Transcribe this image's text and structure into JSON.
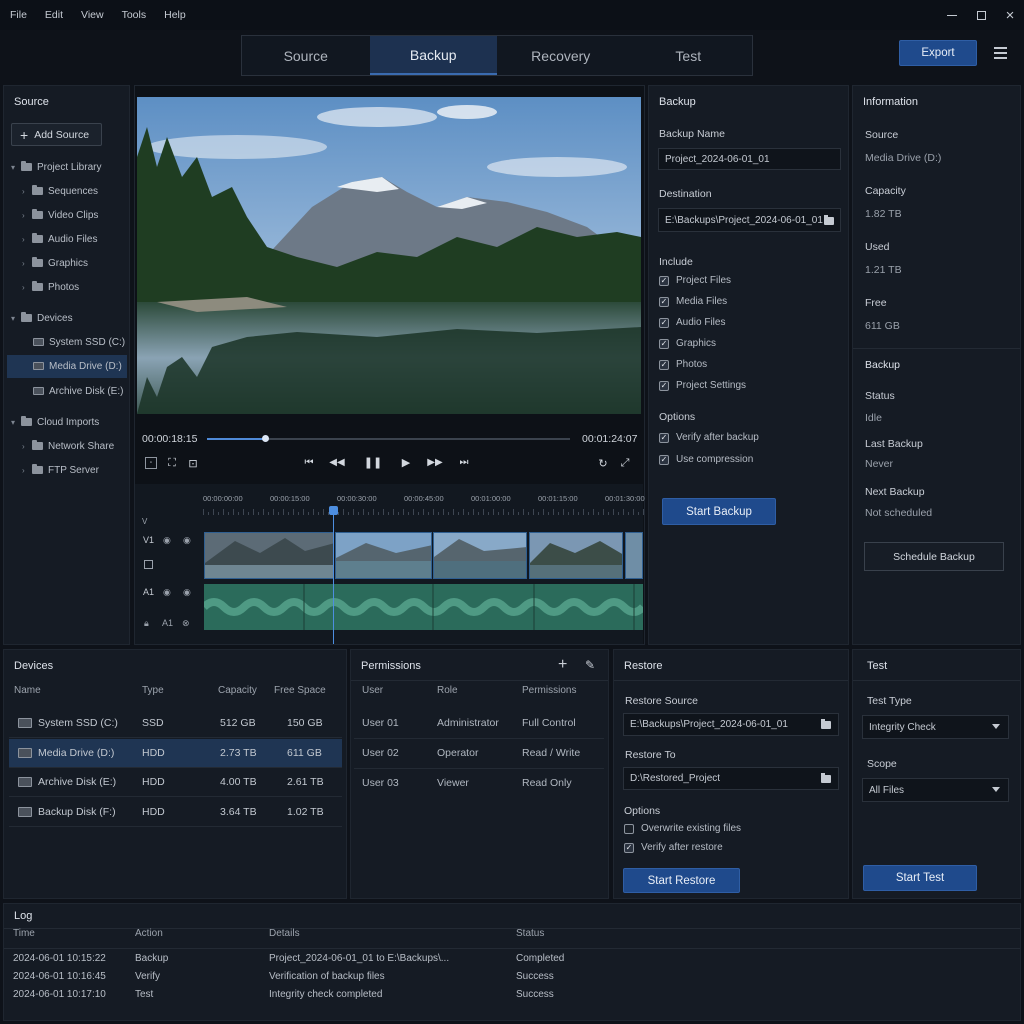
{
  "menu": [
    "File",
    "Edit",
    "View",
    "Tools",
    "Help"
  ],
  "window_icons": [
    "minimize-icon",
    "maximize-icon",
    "close-icon"
  ],
  "tabs": [
    {
      "label": "Source"
    },
    {
      "label": "Backup",
      "active": true
    },
    {
      "label": "Recovery"
    },
    {
      "label": "Test"
    }
  ],
  "export_label": "Export",
  "source_panel": {
    "title": "Source",
    "add_label": "Add Source",
    "library": "Project Library",
    "library_items": [
      "Sequences",
      "Video Clips",
      "Audio Files",
      "Graphics",
      "Photos"
    ],
    "devices": "Devices",
    "device_items": [
      "System SSD (C:)",
      "Media Drive (D:)",
      "Archive Disk (E:)"
    ],
    "selected_device": "Media Drive (D:)",
    "cloud": "Cloud Imports",
    "cloud_items": [
      "Network Share",
      "FTP Server"
    ]
  },
  "player": {
    "current_time": "00:00:18:15",
    "total_time": "00:01:24:07",
    "progress": 0.16
  },
  "timeline": {
    "ruler": [
      "00:00:00:00",
      "00:00:15:00",
      "00:00:30:00",
      "00:00:45:00",
      "00:01:00:00",
      "00:01:15:00",
      "00:01:30:00"
    ],
    "video_track": "V1",
    "audio_track": "A1",
    "audio_track_2": "A1",
    "v_label": "V"
  },
  "backup": {
    "title": "Backup",
    "name_label": "Backup Name",
    "name_value": "Project_2024-06-01_01",
    "dest_label": "Destination",
    "dest_value": "E:\\Backups\\Project_2024-06-01_01",
    "include_label": "Include",
    "include": [
      {
        "label": "Project Files",
        "checked": true
      },
      {
        "label": "Media Files",
        "checked": true
      },
      {
        "label": "Audio Files",
        "checked": true
      },
      {
        "label": "Graphics",
        "checked": true
      },
      {
        "label": "Photos",
        "checked": true
      },
      {
        "label": "Project Settings",
        "checked": true
      }
    ],
    "options_label": "Options",
    "options": [
      {
        "label": "Verify after backup",
        "checked": true
      },
      {
        "label": "Use compression",
        "checked": true
      }
    ],
    "start_label": "Start Backup"
  },
  "info": {
    "title": "Information",
    "source_label": "Source",
    "source_value": "Media Drive (D:)",
    "capacity_label": "Capacity",
    "capacity_value": "1.82 TB",
    "used_label": "Used",
    "used_value": "1.21 TB",
    "free_label": "Free",
    "free_value": "611 GB",
    "backup_heading": "Backup",
    "status_label": "Status",
    "status_value": "Idle",
    "last_label": "Last Backup",
    "last_value": "Never",
    "next_label": "Next Backup",
    "next_value": "Not scheduled",
    "schedule_label": "Schedule Backup"
  },
  "devices_table": {
    "title": "Devices",
    "headers": [
      "Name",
      "Type",
      "Capacity",
      "Free Space"
    ],
    "rows": [
      [
        "System SSD (C:)",
        "SSD",
        "512 GB",
        "150 GB"
      ],
      [
        "Media Drive (D:)",
        "HDD",
        "2.73 TB",
        "611 GB"
      ],
      [
        "Archive Disk (E:)",
        "HDD",
        "4.00 TB",
        "2.61 TB"
      ],
      [
        "Backup Disk (F:)",
        "HDD",
        "3.64 TB",
        "1.02 TB"
      ]
    ],
    "selected_row": 1
  },
  "permissions": {
    "title": "Permissions",
    "headers": [
      "User",
      "Role",
      "Permissions"
    ],
    "rows": [
      [
        "User 01",
        "Administrator",
        "Full Control"
      ],
      [
        "User 02",
        "Operator",
        "Read / Write"
      ],
      [
        "User 03",
        "Viewer",
        "Read Only"
      ]
    ]
  },
  "restore": {
    "title": "Restore",
    "source_label": "Restore Source",
    "source_value": "E:\\Backups\\Project_2024-06-01_01",
    "to_label": "Restore To",
    "to_value": "D:\\Restored_Project",
    "options_label": "Options",
    "options": [
      {
        "label": "Overwrite existing files",
        "checked": false
      },
      {
        "label": "Verify after restore",
        "checked": true
      }
    ],
    "start_label": "Start Restore"
  },
  "test": {
    "title": "Test",
    "type_label": "Test Type",
    "type_value": "Integrity Check",
    "scope_label": "Scope",
    "scope_value": "All Files",
    "start_label": "Start Test"
  },
  "log": {
    "title": "Log",
    "headers": [
      "Time",
      "Action",
      "Details",
      "Status"
    ],
    "rows": [
      [
        "2024-06-01 10:15:22",
        "Backup",
        "Project_2024-06-01_01 to E:\\Backups\\...",
        "Completed"
      ],
      [
        "2024-06-01 10:16:45",
        "Verify",
        "Verification of backup files",
        "Success"
      ],
      [
        "2024-06-01 10:17:10",
        "Test",
        "Integrity check completed",
        "Success"
      ]
    ]
  }
}
